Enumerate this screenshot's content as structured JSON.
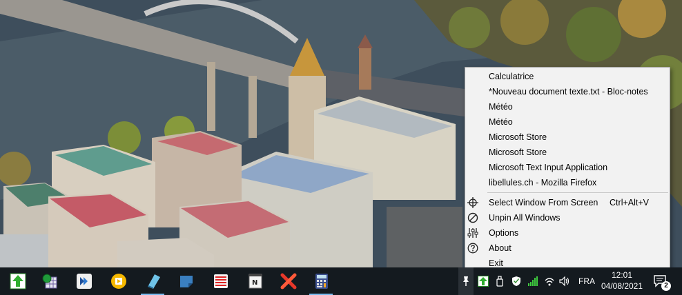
{
  "context_menu": {
    "windows": [
      "Calculatrice",
      "*Nouveau document texte.txt - Bloc-notes",
      "Météo",
      "Météo",
      "Microsoft Store",
      "Microsoft Store",
      "Microsoft Text Input Application",
      "libellules.ch - Mozilla Firefox"
    ],
    "select_window": {
      "label": "Select Window From Screen",
      "shortcut": "Ctrl+Alt+V",
      "icon": "crosshair-icon"
    },
    "unpin_all": {
      "label": "Unpin All Windows",
      "icon": "prohibited-icon"
    },
    "options": {
      "label": "Options",
      "icon": "sliders-icon"
    },
    "about": {
      "label": "About",
      "icon": "question-circle-icon"
    },
    "exit": {
      "label": "Exit"
    }
  },
  "taskbar": {
    "pinned_apps": [
      "green-upload-arrow-icon",
      "spreadsheet-globe-icon",
      "remote-desktop-icon",
      "media-player-icon",
      "notes-book-icon",
      "sticky-note-icon",
      "striped-list-icon",
      "notepad-icon",
      "red-x-icon",
      "calculator-icon"
    ],
    "tray": {
      "icons": [
        "pin-icon",
        "green-upload-arrow-icon",
        "usb-drive-icon",
        "shield-check-icon",
        "signal-bars-icon",
        "wifi-icon",
        "speaker-icon"
      ],
      "language": "FRA",
      "time": "12:01",
      "date": "04/08/2021",
      "notification_count": "2"
    }
  },
  "colors": {
    "menu_background": "#f2f2f2",
    "taskbar_background": "#141a1f",
    "active_indicator": "#76b9ed"
  }
}
